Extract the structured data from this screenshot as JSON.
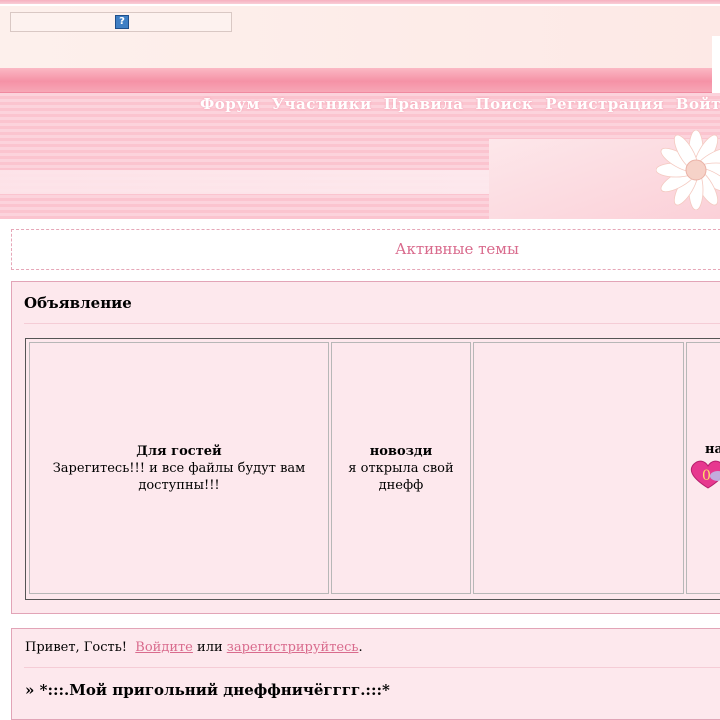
{
  "header": {
    "help_icon_glyph": "?"
  },
  "nav": {
    "items": [
      "Форум",
      "Участники",
      "Правила",
      "Поиск",
      "Регистрация",
      "Войти"
    ]
  },
  "active_topics": {
    "label": "Активные темы"
  },
  "announcement": {
    "title": "Объявление",
    "cells": [
      {
        "heading": "Для гостей",
        "text": "Зарегитесь!!! и все файлы будут вам доступны!!!"
      },
      {
        "heading": "новозди",
        "text": "я открыла свой днефф"
      },
      {
        "heading": "",
        "text": ""
      },
      {
        "heading": "на",
        "badge": "0"
      }
    ]
  },
  "welcome": {
    "greeting": "Привет, Гость!",
    "login_link": "Войдите",
    "or": "или",
    "register_link": "зарегистрируйтесь",
    "period": "."
  },
  "forum": {
    "title": "» *:::.Мой пригольний днеффничёгггг.:::*"
  },
  "colors": {
    "accent": "#d96b8d",
    "banner_pink": "#fbc4cf",
    "panel_bg": "#fde8ed"
  }
}
